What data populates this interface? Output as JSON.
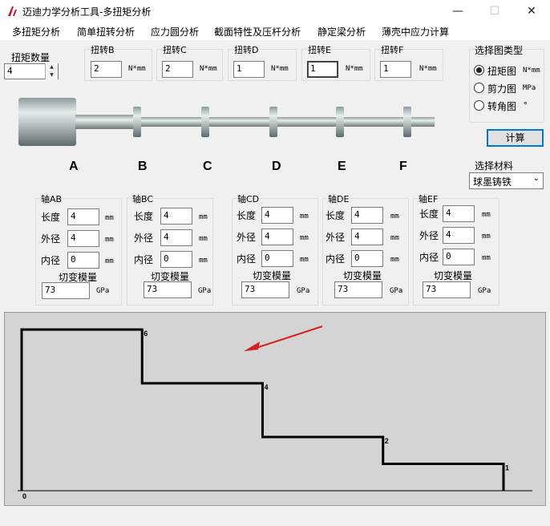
{
  "window": {
    "title": "迈迪力学分析工具-多扭矩分析",
    "minimize": "—",
    "maximize": "☐",
    "close": "✕"
  },
  "menu": [
    "多扭矩分析",
    "简单扭转分析",
    "应力圆分析",
    "截面特性及压杆分析",
    "静定梁分析",
    "薄壳中应力计算"
  ],
  "torque_count": {
    "label": "扭矩数量",
    "value": "4"
  },
  "torques": [
    {
      "label": "扭转B",
      "value": "2",
      "unit": "N*mm"
    },
    {
      "label": "扭转C",
      "value": "2",
      "unit": "N*mm"
    },
    {
      "label": "扭转D",
      "value": "1",
      "unit": "N*mm"
    },
    {
      "label": "扭转E",
      "value": "1",
      "unit": "N*mm"
    },
    {
      "label": "扭转F",
      "value": "1",
      "unit": "N*mm"
    }
  ],
  "diagram_type": {
    "label": "选择图类型",
    "options": [
      {
        "label": "扭矩图",
        "unit": "N*mm",
        "checked": true
      },
      {
        "label": "剪力图",
        "unit": "MPa",
        "checked": false
      },
      {
        "label": "转角图",
        "unit": "°",
        "checked": false
      }
    ]
  },
  "calc_button": "计算",
  "material": {
    "label": "选择材料",
    "value": "球墨铸铁"
  },
  "shaft_letters": [
    "A",
    "B",
    "C",
    "D",
    "E",
    "F"
  ],
  "field_labels": {
    "length": "长度",
    "outer": "外径",
    "inner": "内径",
    "modulus": "切变模量",
    "mm": "mm",
    "gpa": "GPa"
  },
  "segments": [
    {
      "name": "轴AB",
      "length": "4",
      "outer": "4",
      "inner": "0",
      "modulus": "73"
    },
    {
      "name": "轴BC",
      "length": "4",
      "outer": "4",
      "inner": "0",
      "modulus": "73"
    },
    {
      "name": "轴CD",
      "length": "4",
      "outer": "4",
      "inner": "0",
      "modulus": "73"
    },
    {
      "name": "轴DE",
      "length": "4",
      "outer": "4",
      "inner": "0",
      "modulus": "73"
    },
    {
      "name": "轴EF",
      "length": "4",
      "outer": "4",
      "inner": "0",
      "modulus": "73"
    }
  ],
  "chart_data": {
    "type": "line",
    "step": true,
    "x": [
      0,
      1,
      2,
      3,
      4
    ],
    "values": [
      6,
      4,
      2,
      1
    ],
    "value_labels": [
      "6",
      "4",
      "2",
      "1"
    ],
    "baseline_label": "0",
    "ylim": [
      0,
      6
    ],
    "grid": false
  },
  "colors": {
    "plot_bg": "#d4d4d4",
    "line": "#000000",
    "arrow": "#d42020",
    "accent": "#0078d7"
  }
}
